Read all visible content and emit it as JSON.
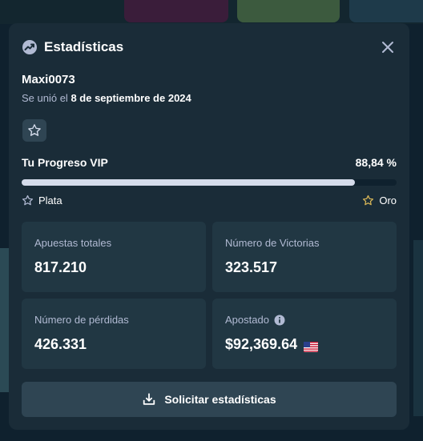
{
  "modal": {
    "title": "Estadísticas",
    "title_icon": "stats-trend-icon",
    "close_icon": "close-icon"
  },
  "user": {
    "username": "Maxi0073",
    "joined_prefix": "Se unió el",
    "joined_date": "8 de septiembre de 2024"
  },
  "vip": {
    "badge_icon": "star-icon",
    "progress_label": "Tu Progreso VIP",
    "progress_text": "88,84 %",
    "progress_fraction": 0.8884,
    "current_rank": "Plata",
    "next_rank": "Oro"
  },
  "stats": [
    {
      "label": "Apuestas totales",
      "value": "817.210"
    },
    {
      "label": "Número de Victorias",
      "value": "323.517"
    },
    {
      "label": "Número de pérdidas",
      "value": "426.331"
    },
    {
      "label": "Apostado",
      "value": "$92,369.64",
      "info_icon": "info-icon",
      "currency_icon": "us-flag-icon"
    }
  ],
  "action": {
    "button_label": "Solicitar estadísticas",
    "button_icon": "download-icon"
  },
  "colors": {
    "modal_bg": "#1a2c38",
    "card_bg": "#213743",
    "button_bg": "#2f4553",
    "muted_text": "#b1bad3",
    "progress_fill": "#d5dceb",
    "gold": "#d8b657"
  }
}
